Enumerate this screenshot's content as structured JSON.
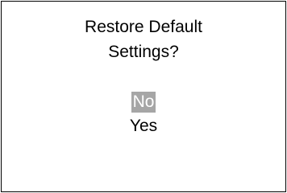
{
  "dialog": {
    "title_line1": "Restore Default",
    "title_line2": "Settings?",
    "options": [
      {
        "label": "No",
        "selected": true
      },
      {
        "label": "Yes",
        "selected": false
      }
    ],
    "colors": {
      "background": "#ffffff",
      "text": "#000000",
      "selection_background": "#a6a6a6",
      "selection_text": "#ffffff",
      "border": "#000000"
    }
  }
}
